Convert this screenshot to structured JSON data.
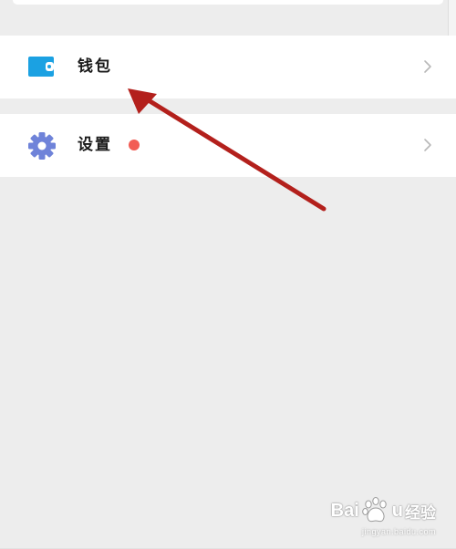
{
  "menu": {
    "items": [
      {
        "label": "钱包",
        "icon": "wallet-icon",
        "icon_color": "#1ba1e2",
        "has_badge": false
      },
      {
        "label": "设置",
        "icon": "gear-icon",
        "icon_color": "#6f83d9",
        "has_badge": true,
        "badge_color": "#f25d55"
      }
    ]
  },
  "watermark": {
    "brand_prefix": "Bai",
    "brand_suffix": "u",
    "brand_cn": "经验",
    "url": "jingyan.baidu.com"
  },
  "colors": {
    "background": "#ededed",
    "row_background": "#ffffff",
    "annotation_arrow": "#b3201c"
  }
}
